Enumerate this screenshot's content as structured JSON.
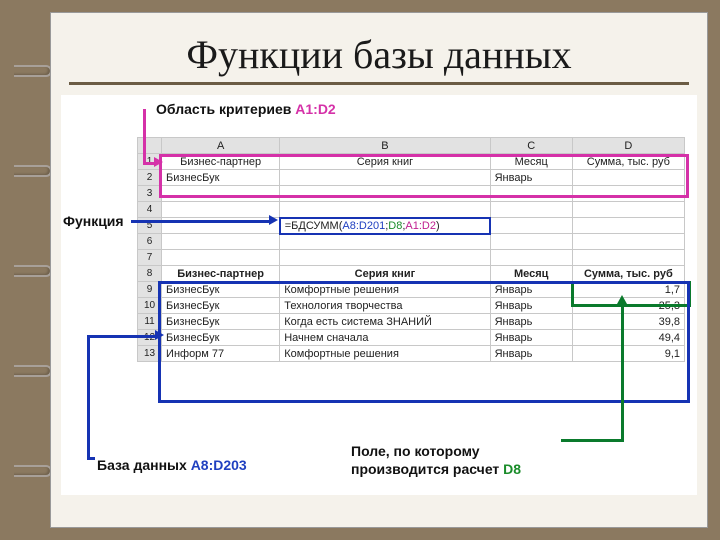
{
  "title": "Функции базы данных",
  "labels": {
    "criteria_prefix": "Область критериев ",
    "criteria_range": "A1:D2",
    "function": "Функция",
    "db_prefix": "База данных ",
    "db_range": "A8:D203",
    "field_line1": "Поле, по которому",
    "field_line2": "производится расчет ",
    "field_ref": "D8"
  },
  "columns": {
    "A": "A",
    "B": "B",
    "C": "C",
    "D": "D"
  },
  "row1": {
    "A": "Бизнес-партнер",
    "B": "Серия книг",
    "C": "Месяц",
    "D": "Сумма, тыс. руб"
  },
  "row2": {
    "A": "БизнесБук",
    "C": "Январь"
  },
  "formula": {
    "prefix": "=БДСУММ(",
    "arg1": "A8:D201",
    "sep1": ";",
    "arg2": "D8",
    "sep2": ";",
    "arg3": "A1:D2",
    "suffix": ")"
  },
  "row8": {
    "A": "Бизнес-партнер",
    "B": "Серия книг",
    "C": "Месяц",
    "D": "Сумма, тыс. руб"
  },
  "data": [
    {
      "n": "9",
      "A": "БизнесБук",
      "B": "Комфортные решения",
      "C": "Январь",
      "D": "1,7"
    },
    {
      "n": "10",
      "A": "БизнесБук",
      "B": "Технология творчества",
      "C": "Январь",
      "D": "25,3"
    },
    {
      "n": "11",
      "A": "БизнесБук",
      "B": "Когда есть система ЗНАНИЙ",
      "C": "Январь",
      "D": "39,8"
    },
    {
      "n": "12",
      "A": "БизнесБук",
      "B": "Начнем сначала",
      "C": "Январь",
      "D": "49,4"
    },
    {
      "n": "13",
      "A": "Информ 77",
      "B": "Комфортные решения",
      "C": "Январь",
      "D": "9,1"
    }
  ]
}
